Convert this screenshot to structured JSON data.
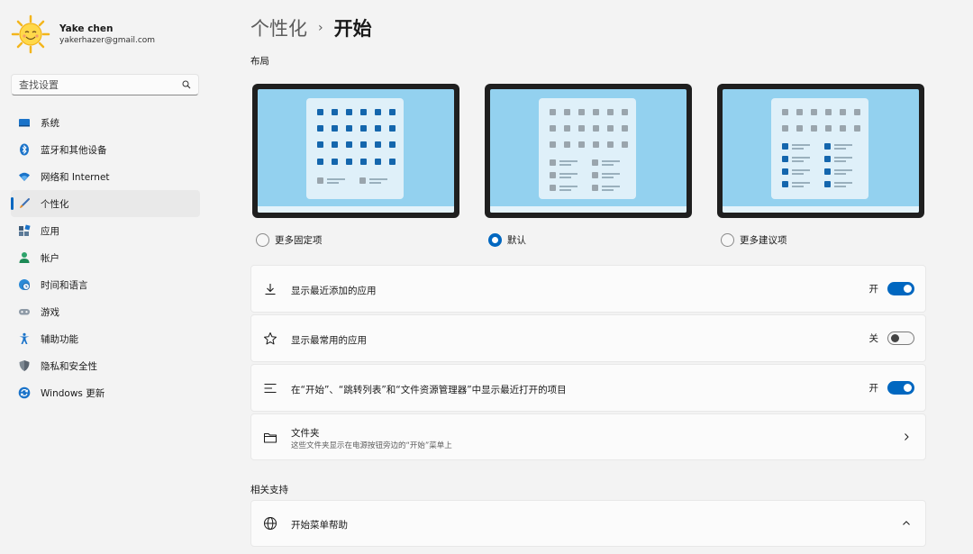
{
  "profile": {
    "name": "Yake chen",
    "email": "yakerhazer@gmail.com"
  },
  "search": {
    "placeholder": "查找设置"
  },
  "nav": {
    "items": [
      {
        "label": "系统",
        "icon": "monitor-icon"
      },
      {
        "label": "蓝牙和其他设备",
        "icon": "bluetooth-icon"
      },
      {
        "label": "网络和 Internet",
        "icon": "wifi-icon"
      },
      {
        "label": "个性化",
        "icon": "brush-icon",
        "active": true
      },
      {
        "label": "应用",
        "icon": "apps-icon"
      },
      {
        "label": "帐户",
        "icon": "person-icon"
      },
      {
        "label": "时间和语言",
        "icon": "globe-clock-icon"
      },
      {
        "label": "游戏",
        "icon": "gamepad-icon"
      },
      {
        "label": "辅助功能",
        "icon": "accessibility-icon"
      },
      {
        "label": "隐私和安全性",
        "icon": "shield-icon"
      },
      {
        "label": "Windows 更新",
        "icon": "update-icon"
      }
    ]
  },
  "breadcrumb": {
    "parent": "个性化",
    "separator": "›",
    "current": "开始"
  },
  "layout_section": {
    "title": "布局",
    "options": [
      {
        "label": "更多固定项",
        "selected": false
      },
      {
        "label": "默认",
        "selected": true
      },
      {
        "label": "更多建议项",
        "selected": false
      }
    ]
  },
  "settings": {
    "recent_apps": {
      "label": "显示最近添加的应用",
      "state": "开",
      "on": true
    },
    "most_used": {
      "label": "显示最常用的应用",
      "state": "关",
      "on": false
    },
    "recent_items": {
      "label": "在“开始”、“跳转列表”和“文件资源管理器”中显示最近打开的项目",
      "state": "开",
      "on": true
    },
    "folders": {
      "label": "文件夹",
      "sub": "这些文件夹显示在电源按钮旁边的“开始”菜单上"
    }
  },
  "related": {
    "title": "相关支持",
    "help": {
      "label": "开始菜单帮助"
    }
  },
  "colors": {
    "accent": "#0067c0",
    "background": "#f3f3f3",
    "card": "#fbfbfb"
  }
}
